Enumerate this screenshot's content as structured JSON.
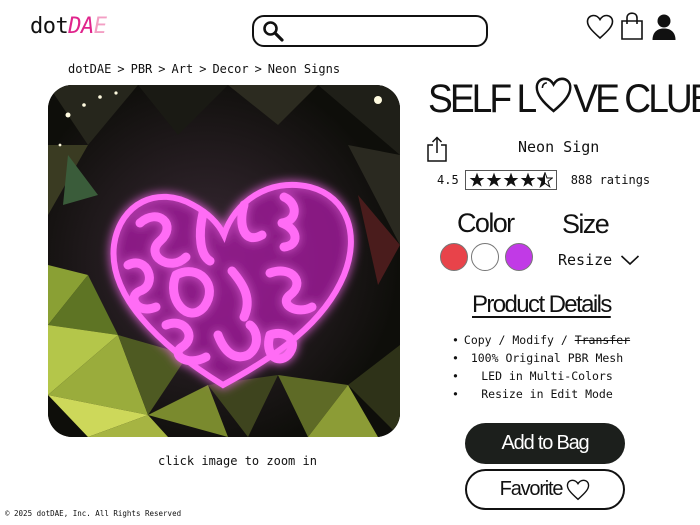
{
  "header": {
    "logo": {
      "part1": "dot",
      "part2": "DA",
      "part3": "E"
    },
    "search": {
      "placeholder": "",
      "icon": "search-icon"
    },
    "icons": [
      "heart-icon",
      "shopping-bag-icon",
      "user-icon"
    ]
  },
  "breadcrumb": [
    "dotDAE",
    ">",
    "PBR",
    ">",
    "Art",
    ">",
    "Decor",
    ">",
    "Neon Signs"
  ],
  "product": {
    "title_pre": "SELF L",
    "title_post": "VE CLUB",
    "type": "Neon Sign",
    "rating": "4.5",
    "rating_value": 4.5,
    "rating_max": 5,
    "rating_count": "888 ratings",
    "image_hint": "click image to zoom in"
  },
  "options": {
    "color_label": "Color",
    "size_label": "Size",
    "colors": [
      "#e8434a",
      "#ffffff",
      "#c13ae6"
    ],
    "size_value": "Resize"
  },
  "details": {
    "heading": "Product Details",
    "feature_1": {
      "a": "Copy / Modify / ",
      "b": "Transfer"
    },
    "feature_2": "100% Original PBR Mesh",
    "feature_3": "LED in Multi-Colors",
    "feature_4": "Resize in Edit Mode"
  },
  "actions": {
    "add_label": "Add to Bag",
    "fav_label": "Favorite"
  },
  "footer": {
    "copyright": "© 2025 dotDAE, Inc. All Rights Reserved"
  }
}
